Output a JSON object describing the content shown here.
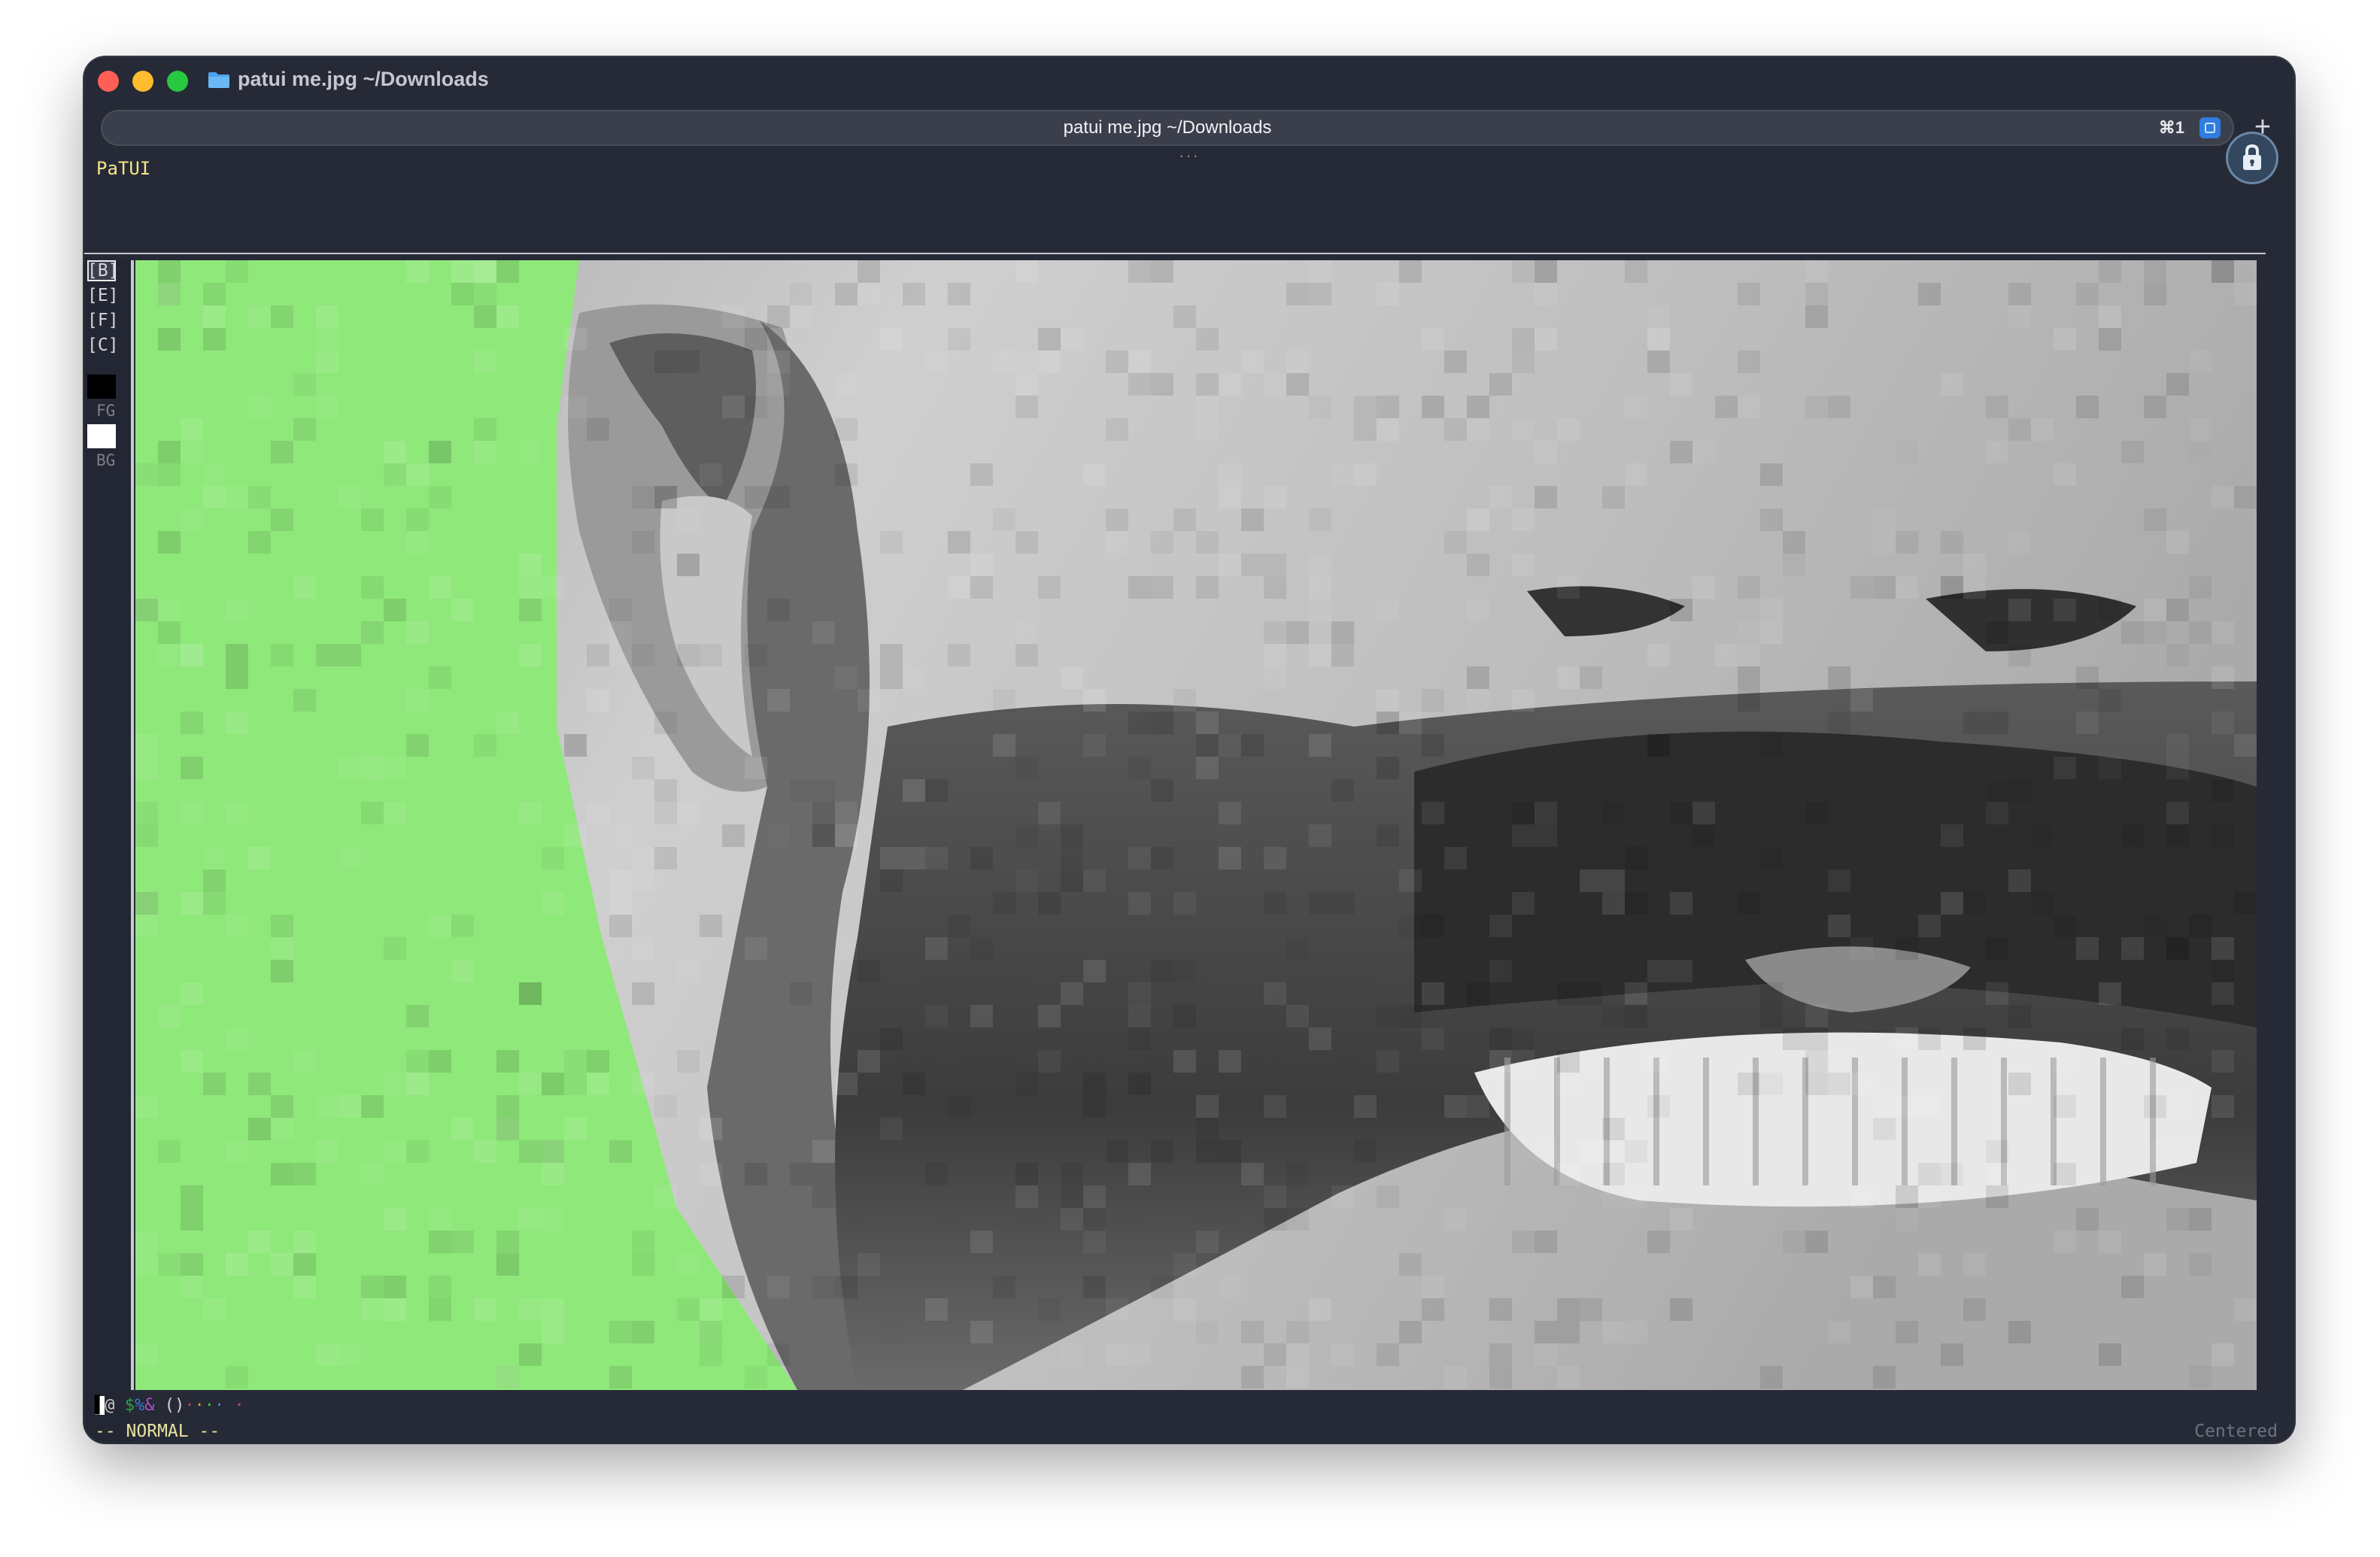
{
  "window": {
    "title": "patui me.jpg ~/Downloads",
    "tab_title": "patui me.jpg ~/Downloads",
    "tab_shortcut": "⌘1",
    "new_tab_label": "+",
    "overflow_dots": "···"
  },
  "app": {
    "name": "PaTUI",
    "tools": [
      {
        "label": "[B]",
        "active": true
      },
      {
        "label": "[E]",
        "active": false
      },
      {
        "label": "[F]",
        "active": false
      },
      {
        "label": "[C]",
        "active": false
      }
    ],
    "fg_label": "FG",
    "bg_label": "BG",
    "fg_color": "#000000",
    "bg_color": "#ffffff",
    "charset": [
      {
        "ch": "▌",
        "color": "#ffffff"
      },
      {
        "ch": "@",
        "color": "#c8c8c8"
      },
      {
        "ch": " ",
        "color": "#c8c8c8"
      },
      {
        "ch": "$",
        "color": "#2aa24a"
      },
      {
        "ch": "%",
        "color": "#3d7ad6"
      },
      {
        "ch": "&",
        "color": "#b04dc8"
      },
      {
        "ch": " ",
        "color": "#c8c8c8"
      },
      {
        "ch": "(",
        "color": "#d6d6d6"
      },
      {
        "ch": ")",
        "color": "#d6d6d6"
      },
      {
        "ch": "·",
        "color": "#c04040"
      },
      {
        "ch": "·",
        "color": "#e0a030"
      },
      {
        "ch": "·",
        "color": "#40c040"
      },
      {
        "ch": "·",
        "color": "#4080e0"
      },
      {
        "ch": " ",
        "color": "#c8c8c8"
      },
      {
        "ch": "·",
        "color": "#c04080"
      }
    ],
    "mode": "-- NORMAL --",
    "alignment": "Centered"
  },
  "colors": {
    "chrome_bg": "#262a36",
    "title_yellow": "#f3e48a",
    "canvas_green": "#8fe87a",
    "accent_blue": "#2f7de0"
  },
  "image": {
    "description_icon": "pixel-art-portrait-canvas"
  }
}
